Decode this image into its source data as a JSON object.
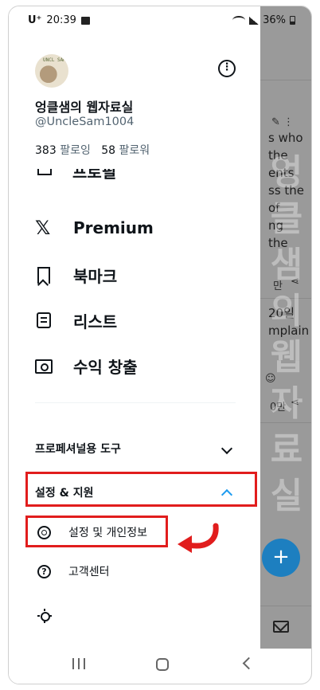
{
  "status_bar": {
    "carrier": "U⁺",
    "time": "20:39",
    "battery": "36%"
  },
  "profile": {
    "avatar_text": "UNCL SAM",
    "display_name": "엉클샘의 웹자료실",
    "handle": "@UncleSam1004",
    "following_count": "383",
    "following_label": "팔로잉",
    "followers_count": "58",
    "followers_label": "팔로워"
  },
  "menu": {
    "partial_label": "프로필",
    "premium": "Premium",
    "bookmarks": "북마크",
    "lists": "리스트",
    "monetization": "수익 창출"
  },
  "sections": {
    "professional_tools": "프로페셔널용 도구",
    "settings_support": "설정 & 지원",
    "settings_privacy": "설정 및 개인정보",
    "help_center": "고객센터"
  },
  "background_feed": {
    "lines": [
      "s who",
      "the",
      "ents",
      "ss the",
      "of",
      "ng",
      "the"
    ],
    "meta1": "만",
    "date": "20일",
    "word": "mplain",
    "meta2": "0만",
    "watermark": "엉클샘의웹자료실"
  },
  "colors": {
    "accent": "#1d9bf0",
    "highlight": "#e11d1d",
    "overlay": "#9a9a9a"
  }
}
